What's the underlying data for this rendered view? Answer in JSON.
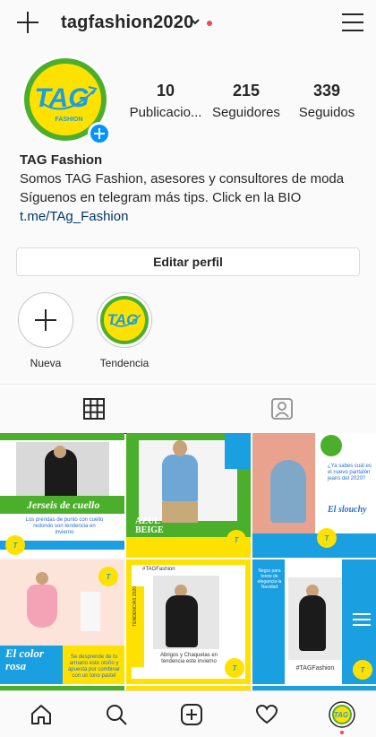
{
  "header": {
    "username": "tagfashion2020"
  },
  "profile": {
    "avatar_text": "TAG",
    "avatar_sub": "FASHION",
    "stats": [
      {
        "value": "10",
        "label": "Publicacio..."
      },
      {
        "value": "215",
        "label": "Seguidores"
      },
      {
        "value": "339",
        "label": "Seguidos"
      }
    ],
    "name": "TAG Fashion",
    "bio_line1": "Somos TAG Fashion, asesores y consultores de moda",
    "bio_line2": "Síguenos en telegram más tips. Click en la BIO",
    "link": "t.me/TAg_Fashion",
    "edit_label": "Editar perfil"
  },
  "highlights": [
    {
      "label": "Nueva"
    },
    {
      "label": "Tendencia"
    }
  ],
  "posts": [
    {
      "title": "Jerseis de cuello",
      "caption": "Los prendas de punto con cuello redondo son tendencia en invierno"
    },
    {
      "title": "AZUL BEIGE",
      "caption": ""
    },
    {
      "title": "El slouchy",
      "caption": "¿Ya sabes cuál es el nuevo pantalón jeans del 2020?"
    },
    {
      "title": "El color rosa",
      "caption": "Se desprende de tu armario este otoño y apuesta por combinar con un tono pastel"
    },
    {
      "title": "TENDENCIAS 2020",
      "caption": "Abrigos y Chaquetas en tendencia este invierno",
      "tag": "#TAGFashion"
    },
    {
      "title": "#TAGFashion",
      "caption": "Negro para tonos de elegancia la Navidad"
    }
  ],
  "colors": {
    "accent_blue": "#0095f6",
    "brand_yellow": "#ffe100",
    "brand_green": "#4caf2b",
    "brand_blue": "#1a9fe0"
  }
}
